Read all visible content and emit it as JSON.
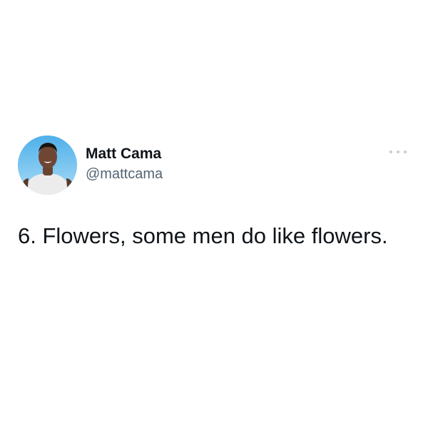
{
  "tweet": {
    "author": {
      "display_name": "Matt Cama",
      "handle": "@mattcama",
      "avatar_icon": "profile-photo"
    },
    "text": "6. Flowers, some men do like flowers.",
    "menu_icon": "more-horizontal-icon"
  },
  "colors": {
    "background": "#ffffff",
    "text_primary": "#0f1419",
    "text_secondary": "#536471",
    "menu_dots": "#c6ccd1"
  }
}
